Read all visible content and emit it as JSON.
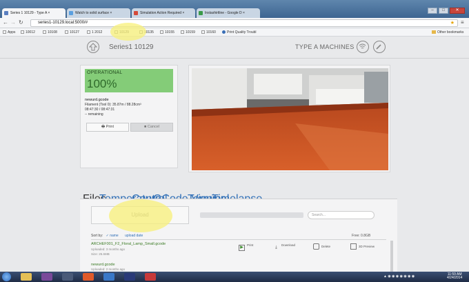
{
  "browser": {
    "tabs": [
      {
        "label": "Series 1 10129 - Type A ×"
      },
      {
        "label": "Watch to solid surface ×"
      },
      {
        "label": "Simulation Action Required ×"
      },
      {
        "label": "Instashirtline - Google D ×"
      }
    ],
    "url": "series1-10129.local:5000/#",
    "bookmarks": [
      {
        "label": "Apps"
      },
      {
        "label": "10012"
      },
      {
        "label": "10108"
      },
      {
        "label": "10127"
      },
      {
        "label": "1 2012"
      },
      {
        "label": "10129"
      },
      {
        "label": "10135"
      },
      {
        "label": "10155"
      },
      {
        "label": "10159"
      },
      {
        "label": "10160"
      },
      {
        "label": "Print Quality Troubl"
      }
    ],
    "other_bookmarks": "Other bookmarks"
  },
  "header": {
    "title": "Series1 10129",
    "machines": "TYPE A MACHINES"
  },
  "status": {
    "state": "OPERATIONAL",
    "percent": "100%",
    "filename": "newurd.gcode",
    "filament": "Filament (Tool 0): 35.87m / 88.28cm³",
    "time": "08:47:30 / 08:47:31",
    "remaining": "-- remaining",
    "print_label": "Print",
    "cancel_label": "Cancel"
  },
  "panel_tabs": [
    "Files",
    "Temperature",
    "Control",
    "GCode Viewer",
    "Terminal",
    "Timelapse"
  ],
  "files": {
    "upload_label": "Upload",
    "search_placeholder": "Search...",
    "sort_by": "Sort by:",
    "sort_name": "✓ name",
    "sort_upload": "upload date",
    "free_space": "Free: 0.8GB",
    "items": [
      {
        "name": "ARCHEF001_F2_Floral_Lamp_Small.gcode",
        "uploaded": "Uploaded: 3 months ago",
        "size": "Size: 25.6MB"
      },
      {
        "name": "newurd.gcode",
        "uploaded": "Uploaded: 2 months ago",
        "size": ""
      }
    ],
    "actions": [
      "Print",
      "Download",
      "Delete",
      "3D Preview"
    ]
  },
  "taskbar": {
    "clock_time": "11:59 AM",
    "clock_date": "4/24/2014"
  },
  "colors": {
    "status_green": "#84cc78",
    "link_blue": "#2e6eb6",
    "file_green": "#3a7a24"
  }
}
